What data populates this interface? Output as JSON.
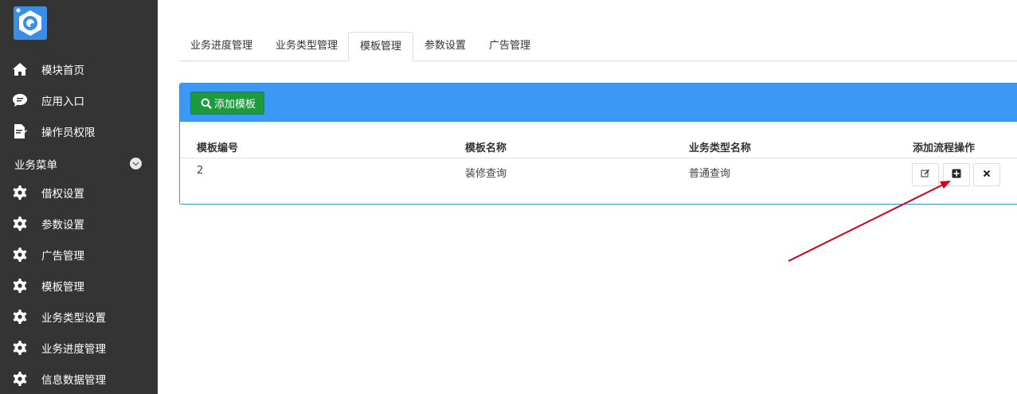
{
  "sidebar": {
    "items": [
      {
        "label": "模块首页",
        "icon": "home-icon"
      },
      {
        "label": "应用入口",
        "icon": "chat-icon"
      },
      {
        "label": "操作员权限",
        "icon": "edit-document-icon"
      }
    ],
    "section_label": "业务菜单",
    "menu": [
      {
        "label": "借权设置",
        "icon": "gear-icon"
      },
      {
        "label": "参数设置",
        "icon": "gear-icon"
      },
      {
        "label": "广告管理",
        "icon": "gear-icon"
      },
      {
        "label": "模板管理",
        "icon": "gear-icon"
      },
      {
        "label": "业务类型设置",
        "icon": "gear-icon"
      },
      {
        "label": "业务进度管理",
        "icon": "gear-icon"
      },
      {
        "label": "信息数据管理",
        "icon": "gear-icon"
      }
    ]
  },
  "tabs": [
    "业务进度管理",
    "业务类型管理",
    "模板管理",
    "参数设置",
    "广告管理"
  ],
  "active_tab": "模板管理",
  "panel": {
    "add_button": "添加模板",
    "columns": [
      "模板编号",
      "模板名称",
      "业务类型名称",
      "添加流程操作"
    ],
    "rows": [
      {
        "id": "2",
        "name": "装修查询",
        "type": "普通查询"
      }
    ]
  },
  "colors": {
    "sidebar_bg": "#343434",
    "panel_header": "#3c98f5",
    "add_button": "#1d9a3c",
    "annotation_arrow": "#d0021b"
  }
}
